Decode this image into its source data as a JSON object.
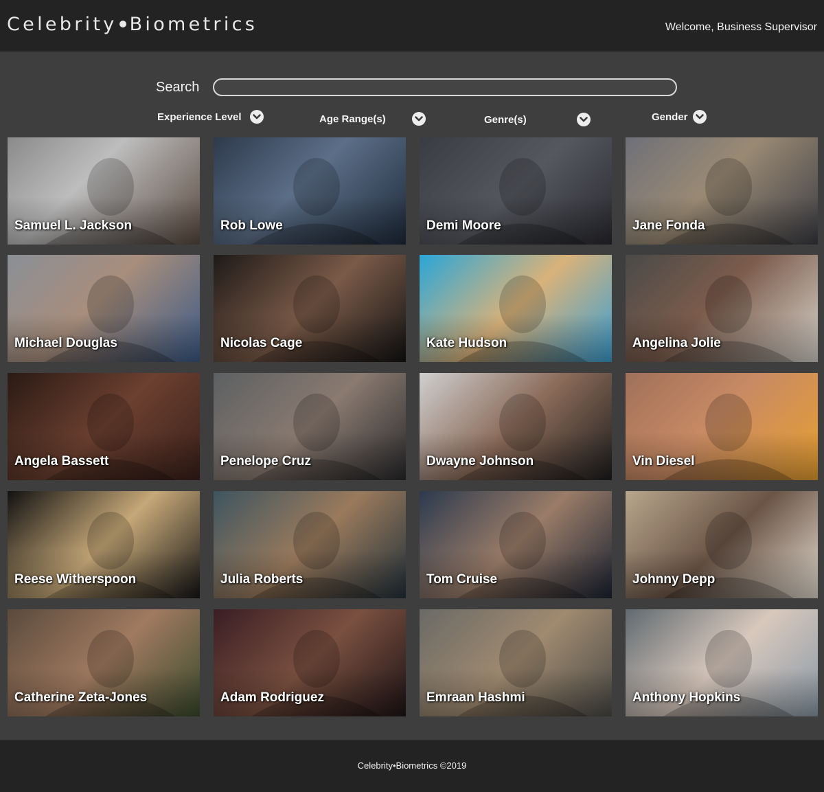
{
  "header": {
    "brand_left": "Celebrity",
    "brand_right": "Biometrics",
    "welcome": "Welcome, Business Supervisor"
  },
  "search": {
    "label": "Search",
    "value": "",
    "placeholder": ""
  },
  "filters": [
    {
      "label": "Experience Level"
    },
    {
      "label": "Age Range(s)"
    },
    {
      "label": "Genre(s)"
    },
    {
      "label": "Gender"
    }
  ],
  "celebrities": [
    {
      "name": "Samuel L. Jackson"
    },
    {
      "name": "Rob Lowe"
    },
    {
      "name": "Demi Moore"
    },
    {
      "name": "Jane Fonda"
    },
    {
      "name": "Michael Douglas"
    },
    {
      "name": "Nicolas Cage"
    },
    {
      "name": "Kate Hudson"
    },
    {
      "name": "Angelina Jolie"
    },
    {
      "name": "Angela Bassett"
    },
    {
      "name": "Penelope Cruz"
    },
    {
      "name": "Dwayne Johnson"
    },
    {
      "name": "Vin Diesel"
    },
    {
      "name": "Reese Witherspoon"
    },
    {
      "name": "Julia Roberts"
    },
    {
      "name": "Tom Cruise"
    },
    {
      "name": "Johnny Depp"
    },
    {
      "name": "Catherine Zeta-Jones"
    },
    {
      "name": "Adam Rodriguez"
    },
    {
      "name": "Emraan Hashmi"
    },
    {
      "name": "Anthony Hopkins"
    }
  ],
  "footer": {
    "text": "Celebrity•Biometrics ©2019"
  },
  "colors": {
    "topbar": "#232323",
    "page_background": "#3e3e3e",
    "text": "#ffffff"
  }
}
